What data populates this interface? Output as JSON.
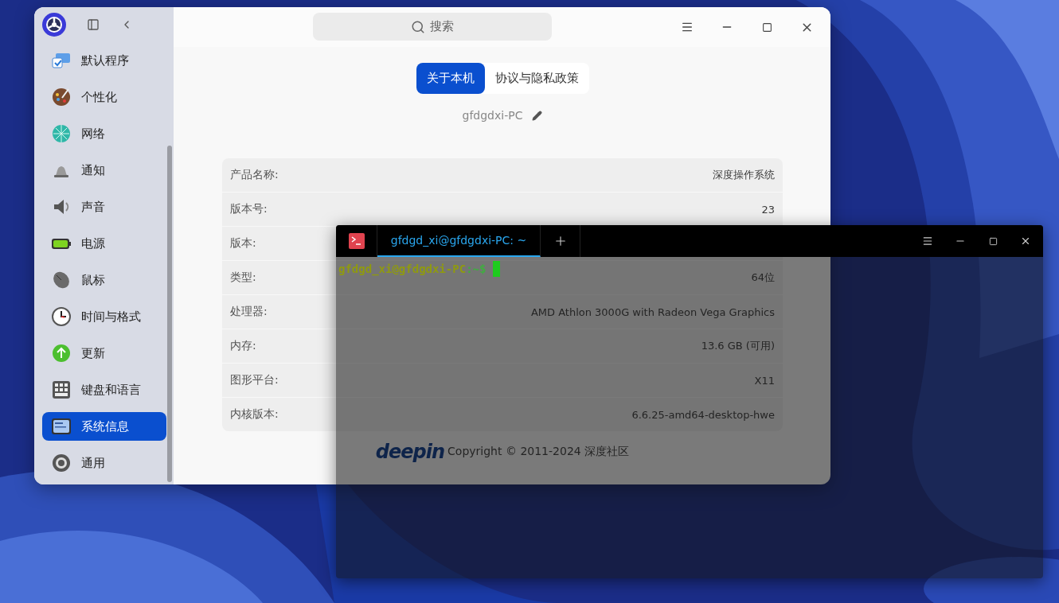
{
  "settings_window": {
    "search": {
      "placeholder": "搜索"
    },
    "sidebar": {
      "items": [
        {
          "label": "默认程序",
          "selected": false
        },
        {
          "label": "个性化",
          "selected": false
        },
        {
          "label": "网络",
          "selected": false
        },
        {
          "label": "通知",
          "selected": false
        },
        {
          "label": "声音",
          "selected": false
        },
        {
          "label": "电源",
          "selected": false
        },
        {
          "label": "鼠标",
          "selected": false
        },
        {
          "label": "时间与格式",
          "selected": false
        },
        {
          "label": "更新",
          "selected": false
        },
        {
          "label": "键盘和语言",
          "selected": false
        },
        {
          "label": "系统信息",
          "selected": true
        },
        {
          "label": "通用",
          "selected": false
        }
      ]
    },
    "tabs": [
      {
        "label": "关于本机",
        "selected": true
      },
      {
        "label": "协议与隐私政策",
        "selected": false
      }
    ],
    "hostname": "gfdgdxi-PC",
    "info_rows": [
      {
        "label": "产品名称:",
        "value": "深度操作系统"
      },
      {
        "label": "版本号:",
        "value": "23"
      },
      {
        "label": "版本:"
      },
      {
        "label": "类型:",
        "value": "64位"
      },
      {
        "label": "处理器:",
        "value": "AMD Athlon 3000G with Radeon Vega Graphics"
      },
      {
        "label": "内存:",
        "value": "13.6 GB (可用)"
      },
      {
        "label": "图形平台:",
        "value": "X11"
      },
      {
        "label": "内核版本:",
        "value": "6.6.25-amd64-desktop-hwe"
      }
    ],
    "footer": {
      "logo": "deepin",
      "copyright": "Copyright © 2011-2024 深度社区"
    }
  },
  "terminal": {
    "tabs": [
      {
        "label": "gfdgd_xi@gfdgdxi-PC: ~",
        "selected": true
      }
    ],
    "prompt": {
      "user_host": "gfdgd_xi@gfdgdxi-PC",
      "path": ":~$"
    }
  }
}
